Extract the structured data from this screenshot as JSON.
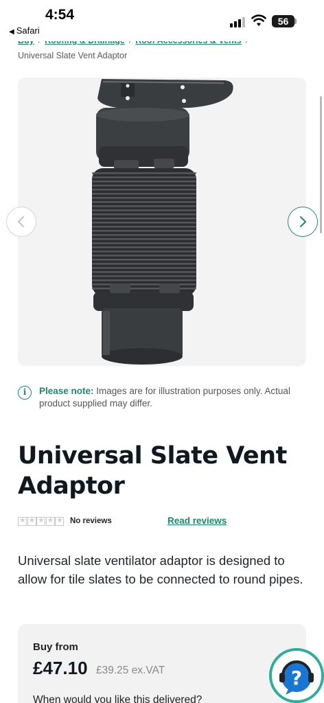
{
  "status_bar": {
    "time": "4:54",
    "back_app": "Safari",
    "battery": "56"
  },
  "breadcrumb": {
    "items": [
      "Buy",
      "Roofing & Drainage",
      "Roof Accessories & Vents"
    ],
    "separator": "/",
    "current": "Universal Slate Vent Adaptor"
  },
  "gallery": {
    "image_alt": "Universal Slate Vent Adaptor",
    "prev_icon": "chevron-left-icon",
    "next_icon": "chevron-right-icon"
  },
  "note": {
    "label": "Please note:",
    "text": "Images are for illustration purposes only. Actual product supplied may differ."
  },
  "product": {
    "title": "Universal Slate Vent Adaptor",
    "reviews_count": "No reviews",
    "read_reviews": "Read reviews",
    "description": "Universal slate ventilator adaptor is designed to allow for tile slates to be connected to round pipes."
  },
  "pricing": {
    "buy_from": "Buy from",
    "price": "£47.10",
    "ex_vat": "£39.25 ex.VAT",
    "delivery_question": "When would you like this delivered?"
  },
  "colors": {
    "accent": "#1b8a6b",
    "help_ring": "#2ab09a",
    "help_blue": "#1877d2"
  }
}
